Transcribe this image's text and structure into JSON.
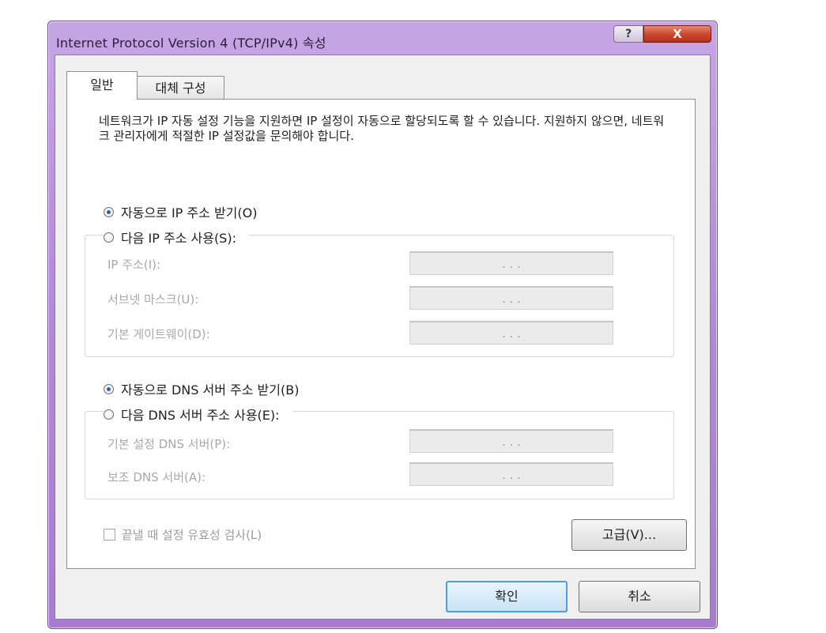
{
  "window": {
    "title": "Internet Protocol Version 4 (TCP/IPv4) 속성",
    "help_label": "?",
    "close_label": "X"
  },
  "tabs": [
    {
      "label": "일반",
      "selected": true
    },
    {
      "label": "대체 구성",
      "selected": false
    }
  ],
  "description": "네트워크가 IP 자동 설정 기능을 지원하면 IP 설정이 자동으로 할당되도록 할 수 있습니다. 지원하지 않으면, 네트워크 관리자에게 적절한 IP 설정값을 문의해야 합니다.",
  "ip_section": {
    "auto_label": "자동으로 IP 주소 받기(O)",
    "auto_selected": true,
    "manual_label": "다음 IP 주소 사용(S):",
    "fields": [
      {
        "label": "IP 주소(I):",
        "value": ". . ."
      },
      {
        "label": "서브넷 마스크(U):",
        "value": ". . ."
      },
      {
        "label": "기본 게이트웨이(D):",
        "value": ". . ."
      }
    ]
  },
  "dns_section": {
    "auto_label": "자동으로 DNS 서버 주소 받기(B)",
    "auto_selected": true,
    "manual_label": "다음 DNS 서버 주소 사용(E):",
    "fields": [
      {
        "label": "기본 설정 DNS 서버(P):",
        "value": ". . ."
      },
      {
        "label": "보조 DNS 서버(A):",
        "value": ". . ."
      }
    ]
  },
  "validate_label": "끝낼 때 설정 유효성 검사(L)",
  "validate_checked": false,
  "buttons": {
    "advanced": "고급(V)...",
    "ok": "확인",
    "cancel": "취소"
  },
  "colors": {
    "frame": "#b48bd7",
    "close_button": "#c9452c",
    "default_button_border": "#4f9fd6"
  }
}
